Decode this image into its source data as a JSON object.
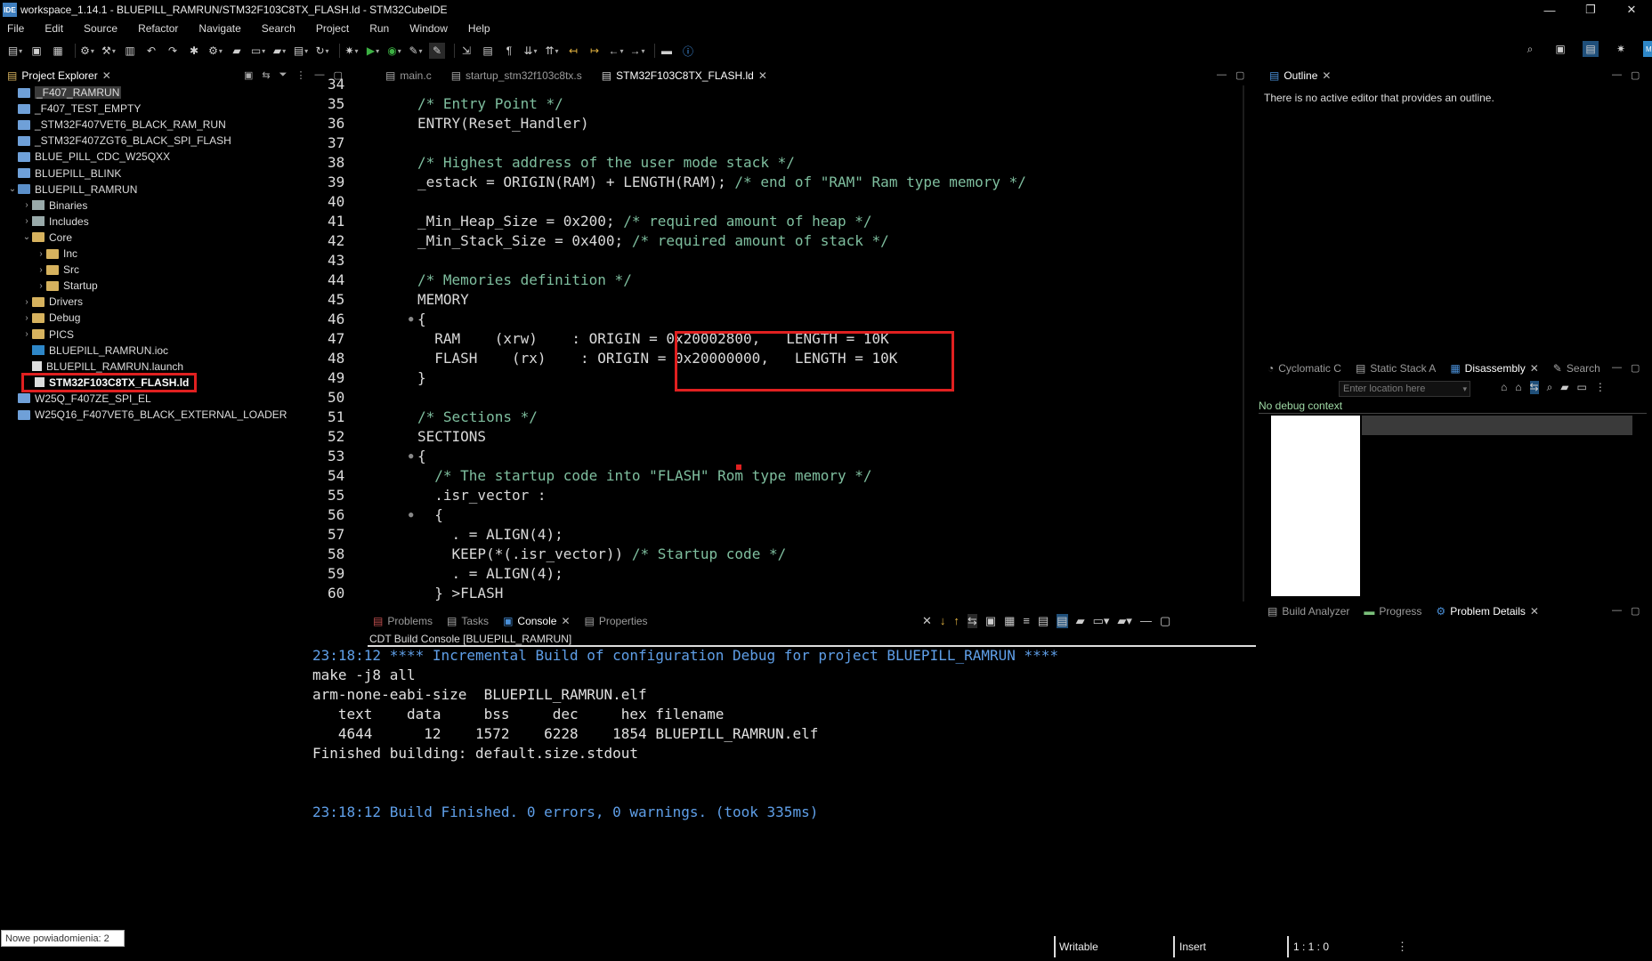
{
  "window": {
    "icon_text": "IDE",
    "title": "workspace_1.14.1 - BLUEPILL_RAMRUN/STM32F103C8TX_FLASH.ld - STM32CubeIDE",
    "minimize": "—",
    "maximize": "❐",
    "close": "✕"
  },
  "menu": [
    "File",
    "Edit",
    "Source",
    "Refactor",
    "Navigate",
    "Search",
    "Project",
    "Run",
    "Window",
    "Help"
  ],
  "project_explorer": {
    "title": "Project Explorer",
    "items": [
      {
        "label": "_F407_RAMRUN",
        "icon": "project-icon",
        "level": 0,
        "twisty": ""
      },
      {
        "label": "_F407_TEST_EMPTY",
        "icon": "project-icon",
        "level": 0,
        "twisty": ""
      },
      {
        "label": "_STM32F407VET6_BLACK_RAM_RUN",
        "icon": "project-icon",
        "level": 0,
        "twisty": ""
      },
      {
        "label": "_STM32F407ZGT6_BLACK_SPI_FLASH",
        "icon": "project-icon",
        "level": 0,
        "twisty": ""
      },
      {
        "label": "BLUE_PILL_CDC_W25QXX",
        "icon": "project-icon",
        "level": 0,
        "twisty": ""
      },
      {
        "label": "BLUEPILL_BLINK",
        "icon": "project-icon",
        "level": 0,
        "twisty": ""
      },
      {
        "label": "BLUEPILL_RAMRUN",
        "icon": "ide-project-icon",
        "level": 0,
        "twisty": "v"
      },
      {
        "label": "Binaries",
        "icon": "binaries-icon",
        "level": 1,
        "twisty": ">"
      },
      {
        "label": "Includes",
        "icon": "includes-icon",
        "level": 1,
        "twisty": ">"
      },
      {
        "label": "Core",
        "icon": "folder-icon",
        "level": 1,
        "twisty": "v"
      },
      {
        "label": "Inc",
        "icon": "folder-icon",
        "level": 2,
        "twisty": ">"
      },
      {
        "label": "Src",
        "icon": "folder-icon",
        "level": 2,
        "twisty": ">"
      },
      {
        "label": "Startup",
        "icon": "folder-icon",
        "level": 2,
        "twisty": ">"
      },
      {
        "label": "Drivers",
        "icon": "folder-icon",
        "level": 1,
        "twisty": ">"
      },
      {
        "label": "Debug",
        "icon": "folder-icon",
        "level": 1,
        "twisty": ">"
      },
      {
        "label": "PICS",
        "icon": "folder-icon",
        "level": 1,
        "twisty": ">"
      },
      {
        "label": "BLUEPILL_RAMRUN.ioc",
        "icon": "mx-file-icon",
        "level": 1,
        "twisty": ""
      },
      {
        "label": "BLUEPILL_RAMRUN.launch",
        "icon": "launch-file-icon",
        "level": 1,
        "twisty": ""
      },
      {
        "label": "STM32F103C8TX_FLASH.ld",
        "icon": "linker-file-icon",
        "level": 1,
        "twisty": "",
        "selected": true
      },
      {
        "label": "W25Q_F407ZE_SPI_EL",
        "icon": "project-icon",
        "level": 0,
        "twisty": ""
      },
      {
        "label": "W25Q16_F407VET6_BLACK_EXTERNAL_LOADER",
        "icon": "project-icon",
        "level": 0,
        "twisty": ""
      }
    ]
  },
  "editor": {
    "tabs": [
      {
        "label": "main.c",
        "active": false
      },
      {
        "label": "startup_stm32f103c8tx.s",
        "active": false
      },
      {
        "label": "STM32F103C8TX_FLASH.ld",
        "active": true
      }
    ],
    "lines": [
      {
        "n": "34",
        "code": "",
        "comment": ""
      },
      {
        "n": "35",
        "code": "",
        "comment": "/* Entry Point */"
      },
      {
        "n": "36",
        "code": "ENTRY(Reset_Handler)",
        "comment": ""
      },
      {
        "n": "37",
        "code": "",
        "comment": ""
      },
      {
        "n": "38",
        "code": "",
        "comment": "/* Highest address of the user mode stack */"
      },
      {
        "n": "39",
        "code": "_estack = ORIGIN(RAM) + LENGTH(RAM); ",
        "comment": "/* end of \"RAM\" Ram type memory */"
      },
      {
        "n": "40",
        "code": "",
        "comment": ""
      },
      {
        "n": "41",
        "code": "_Min_Heap_Size = 0x200; ",
        "comment": "/* required amount of heap */"
      },
      {
        "n": "42",
        "code": "_Min_Stack_Size = 0x400; ",
        "comment": "/* required amount of stack */"
      },
      {
        "n": "43",
        "code": "",
        "comment": ""
      },
      {
        "n": "44",
        "code": "",
        "comment": "/* Memories definition */"
      },
      {
        "n": "45",
        "code": "MEMORY",
        "comment": ""
      },
      {
        "n": "46",
        "code": "{",
        "comment": "",
        "fold": true
      },
      {
        "n": "47",
        "code": "  RAM    (xrw)    : ORIGIN = 0x20002800,   LENGTH = 10K",
        "comment": ""
      },
      {
        "n": "48",
        "code": "  FLASH    (rx)    : ORIGIN = 0x20000000,   LENGTH = 10K",
        "comment": ""
      },
      {
        "n": "49",
        "code": "}",
        "comment": ""
      },
      {
        "n": "50",
        "code": "",
        "comment": ""
      },
      {
        "n": "51",
        "code": "",
        "comment": "/* Sections */"
      },
      {
        "n": "52",
        "code": "SECTIONS",
        "comment": ""
      },
      {
        "n": "53",
        "code": "{",
        "comment": "",
        "fold": true
      },
      {
        "n": "54",
        "code": "  ",
        "comment": "/* The startup code into \"FLASH\" Rom type memory */"
      },
      {
        "n": "55",
        "code": "  .isr_vector :",
        "comment": ""
      },
      {
        "n": "56",
        "code": "  {",
        "comment": "",
        "fold": true
      },
      {
        "n": "57",
        "code": "    . = ALIGN(4);",
        "comment": ""
      },
      {
        "n": "58",
        "code": "    KEEP(*(.isr_vector)) ",
        "comment": "/* Startup code */"
      },
      {
        "n": "59",
        "code": "    . = ALIGN(4);",
        "comment": ""
      },
      {
        "n": "60",
        "code": "  } >FLASH",
        "comment": ""
      }
    ]
  },
  "outline": {
    "title": "Outline",
    "message": "There is no active editor that provides an outline."
  },
  "disassembly_panel": {
    "tabs": [
      "Cyclomatic C",
      "Static Stack A",
      "Disassembly",
      "Search"
    ],
    "active": "Disassembly",
    "location_placeholder": "Enter location here",
    "no_debug": "No debug context"
  },
  "bottom_right_panel": {
    "tabs": [
      "Build Analyzer",
      "Progress",
      "Problem Details"
    ],
    "active": "Problem Details"
  },
  "console_panel": {
    "tabs": [
      "Problems",
      "Tasks",
      "Console",
      "Properties"
    ],
    "active": "Console",
    "subtitle": "CDT Build Console [BLUEPILL_RAMRUN]",
    "lines": [
      {
        "text": "23:18:12 **** Incremental Build of configuration Debug for project BLUEPILL_RAMRUN ****",
        "blue": true
      },
      {
        "text": "make -j8 all",
        "blue": false
      },
      {
        "text": "arm-none-eabi-size  BLUEPILL_RAMRUN.elf",
        "blue": false
      },
      {
        "text": "   text    data     bss     dec     hex filename",
        "blue": false
      },
      {
        "text": "   4644      12    1572    6228    1854 BLUEPILL_RAMRUN.elf",
        "blue": false
      },
      {
        "text": "Finished building: default.size.stdout",
        "blue": false
      },
      {
        "text": "",
        "blue": false
      },
      {
        "text": "",
        "blue": false
      },
      {
        "text": "23:18:12 Build Finished. 0 errors, 0 warnings. (took 335ms)",
        "blue": true
      }
    ]
  },
  "status": {
    "notification": "Nowe powiadomienia: 2",
    "writable": "Writable",
    "insert": "Insert",
    "position": "1 : 1 : 0"
  },
  "colors": {
    "highlight_box": "#e02020",
    "comment": "#7fbf9f",
    "console_blue": "#5f9fe8",
    "tab_accent": "#4a90d9"
  }
}
